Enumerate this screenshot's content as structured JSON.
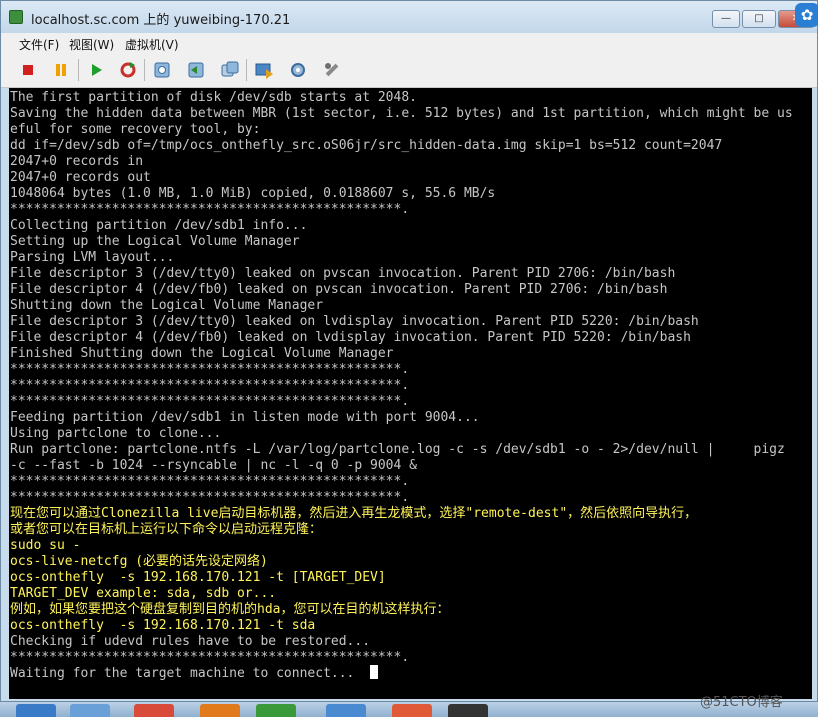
{
  "window": {
    "title": "localhost.sc.com 上的 yuweibing-170.21",
    "controls": {
      "minimize": "—",
      "maximize": "□",
      "close": "✕"
    }
  },
  "menubar": {
    "file": "文件(F)",
    "view": "视图(W)",
    "vm": "虚拟机(V)"
  },
  "toolbar": {
    "icons": [
      "stop-icon",
      "pause-icon",
      "play-icon",
      "reset-icon",
      "snapshot-icon",
      "revert-snapshot-icon",
      "manage-snapshots-icon",
      "send-ctrl-alt-del-icon",
      "settings-icon",
      "tools-icon"
    ],
    "colors": {
      "stop": "#d21f1f",
      "pause": "#f0a000",
      "play": "#1e9e2a",
      "reset": "#c8302c"
    }
  },
  "terminal": {
    "lines": [
      {
        "t": "The first partition of disk /dev/sdb starts at 2048.",
        "c": "g"
      },
      {
        "t": "Saving the hidden data between MBR (1st sector, i.e. 512 bytes) and 1st partition, which might be us",
        "c": "g"
      },
      {
        "t": "eful for some recovery tool, by:",
        "c": "g"
      },
      {
        "t": "dd if=/dev/sdb of=/tmp/ocs_onthefly_src.oS06jr/src_hidden-data.img skip=1 bs=512 count=2047",
        "c": "g"
      },
      {
        "t": "2047+0 records in",
        "c": "g"
      },
      {
        "t": "2047+0 records out",
        "c": "g"
      },
      {
        "t": "1048064 bytes (1.0 MB, 1.0 MiB) copied, 0.0188607 s, 55.6 MB/s",
        "c": "g"
      },
      {
        "t": "**************************************************.",
        "c": "g"
      },
      {
        "t": "Collecting partition /dev/sdb1 info...",
        "c": "g"
      },
      {
        "t": "Setting up the Logical Volume Manager",
        "c": "g"
      },
      {
        "t": "Parsing LVM layout...",
        "c": "g"
      },
      {
        "t": "File descriptor 3 (/dev/tty0) leaked on pvscan invocation. Parent PID 2706: /bin/bash",
        "c": "g"
      },
      {
        "t": "File descriptor 4 (/dev/fb0) leaked on pvscan invocation. Parent PID 2706: /bin/bash",
        "c": "g"
      },
      {
        "t": "Shutting down the Logical Volume Manager",
        "c": "g"
      },
      {
        "t": "File descriptor 3 (/dev/tty0) leaked on lvdisplay invocation. Parent PID 5220: /bin/bash",
        "c": "g"
      },
      {
        "t": "File descriptor 4 (/dev/fb0) leaked on lvdisplay invocation. Parent PID 5220: /bin/bash",
        "c": "g"
      },
      {
        "t": "Finished Shutting down the Logical Volume Manager",
        "c": "g"
      },
      {
        "t": "**************************************************.",
        "c": "g"
      },
      {
        "t": "**************************************************.",
        "c": "g"
      },
      {
        "t": "**************************************************.",
        "c": "g"
      },
      {
        "t": "Feeding partition /dev/sdb1 in listen mode with port 9004...",
        "c": "g"
      },
      {
        "t": "Using partclone to clone...",
        "c": "g"
      },
      {
        "t": "Run partclone: partclone.ntfs -L /var/log/partclone.log -c -s /dev/sdb1 -o - 2>/dev/null |     pigz",
        "c": "g"
      },
      {
        "t": "-c --fast -b 1024 --rsyncable | nc -l -q 0 -p 9004 &",
        "c": "g"
      },
      {
        "t": "**************************************************.",
        "c": "g"
      },
      {
        "t": "**************************************************.",
        "c": "g"
      },
      {
        "t": "现在您可以通过Clonezilla live启动目标机器，然后进入再生龙模式，选择\"remote-dest\"，然后依照向导执行，",
        "c": "y"
      },
      {
        "t": "或者您可以在目标机上运行以下命令以启动远程克隆：",
        "c": "y"
      },
      {
        "t": "sudo su -",
        "c": "y"
      },
      {
        "t": "ocs-live-netcfg (必要的话先设定网络)",
        "c": "y"
      },
      {
        "t": "ocs-onthefly  -s 192.168.170.121 -t [TARGET_DEV]",
        "c": "y"
      },
      {
        "t": "TARGET_DEV example: sda, sdb or...",
        "c": "y"
      },
      {
        "t": "例如，如果您要把这个硬盘复制到目的机的hda，您可以在目的机这样执行：",
        "c": "y"
      },
      {
        "t": "ocs-onthefly  -s 192.168.170.121 -t sda",
        "c": "y"
      },
      {
        "t": "Checking if udevd rules have to be restored...",
        "c": "g"
      },
      {
        "t": "**************************************************.",
        "c": "g"
      },
      {
        "t": "Waiting for the target machine to connect...",
        "c": "g"
      }
    ]
  },
  "watermark": "@51CTO博客"
}
